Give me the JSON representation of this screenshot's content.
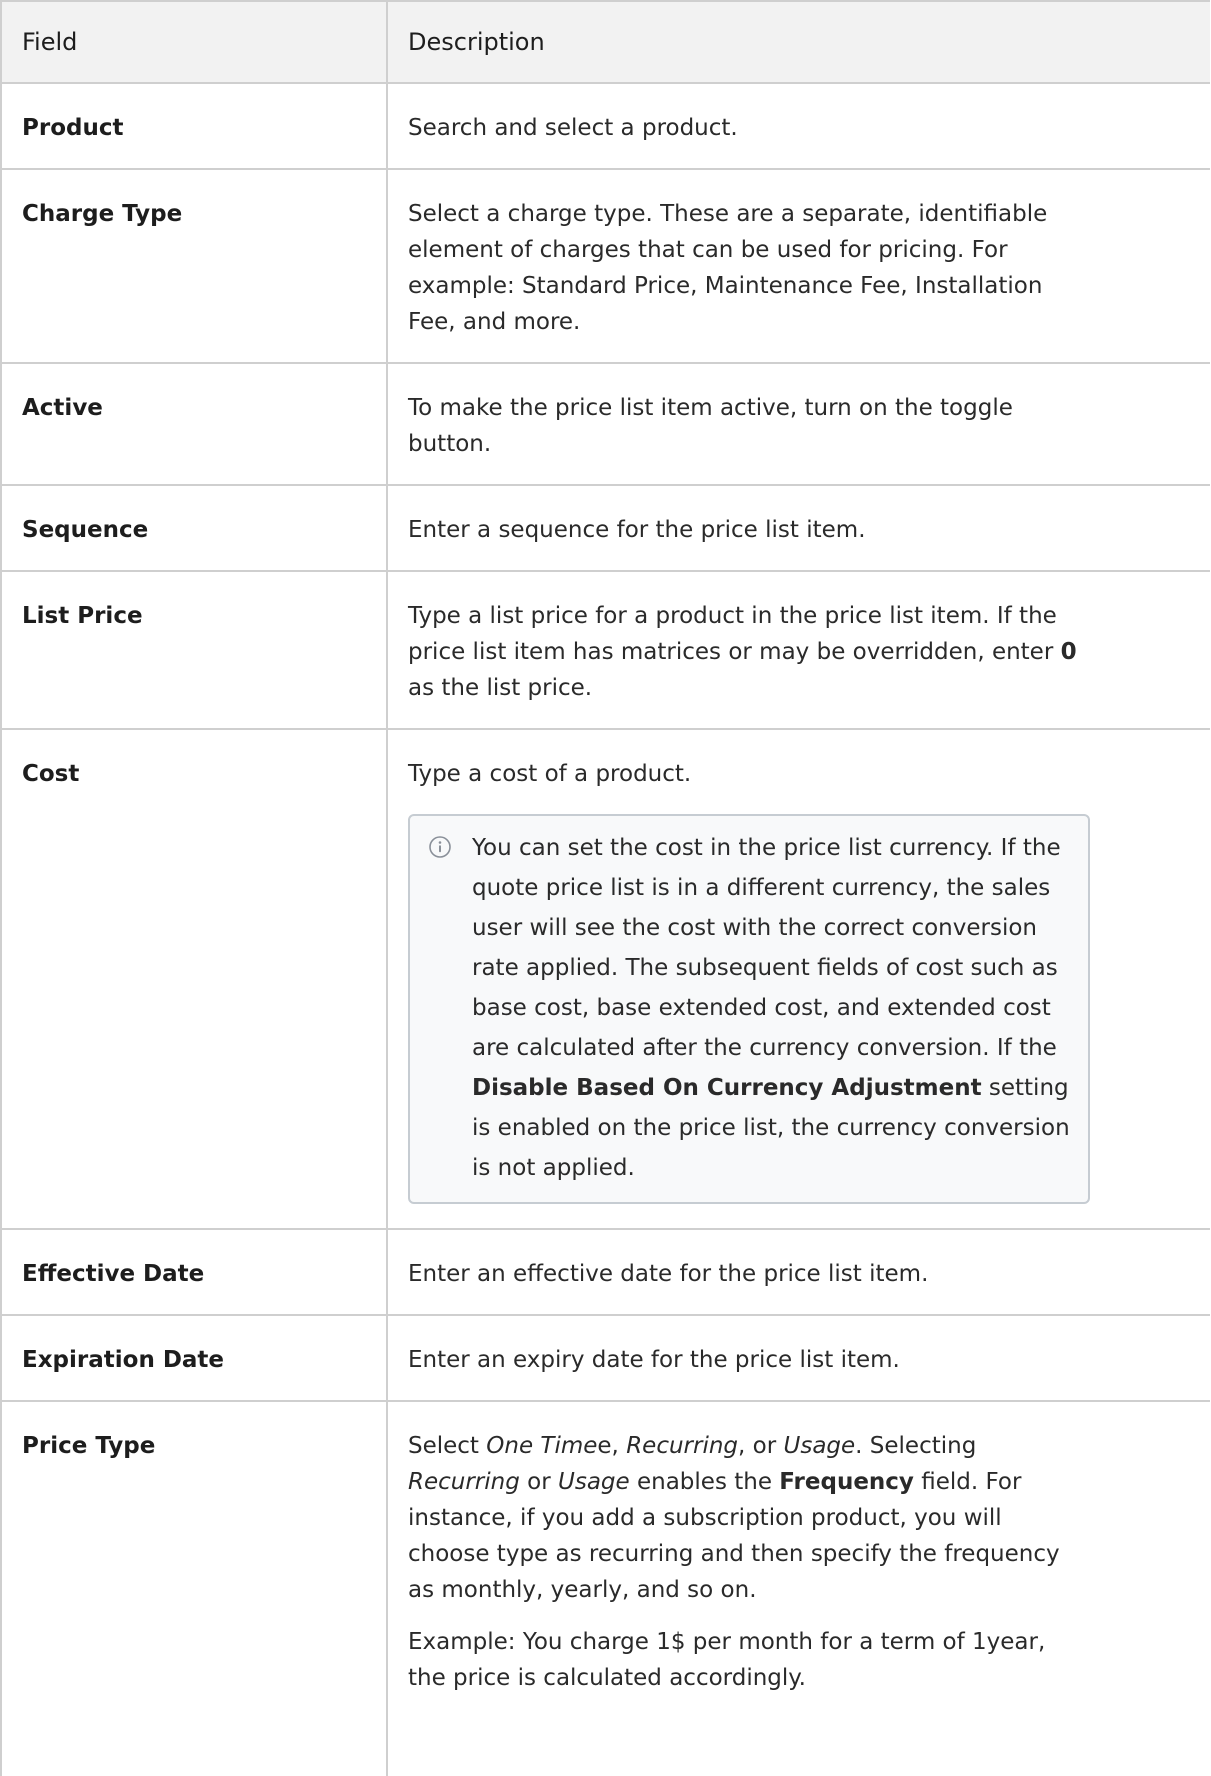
{
  "table": {
    "headers": {
      "field": "Field",
      "description": "Description"
    },
    "rows": [
      {
        "field": "Product",
        "description": "Search and select a product."
      },
      {
        "field": "Charge Type",
        "description": "Select a charge type. These are a separate, identifiable element of charges that can be used for pricing. For example: Standard Price, Maintenance Fee, Installation Fee, and more."
      },
      {
        "field": "Active",
        "description": "To make the price list item active, turn on the toggle button."
      },
      {
        "field": "Sequence",
        "description": "Enter a sequence for the price list item."
      },
      {
        "field": "List Price",
        "description": {
          "before": "Type a list price for a product in the price list item. If the price list item has matrices or may be overridden, enter ",
          "bold": "0",
          "after": " as the list price."
        }
      },
      {
        "field": "Cost",
        "description": "Type a cost of a product.",
        "note": {
          "icon": "info-icon",
          "before": "You can set the cost in the price list currency. If the quote price list is in a different currency, the sales user will see the cost with the correct conversion rate applied. The subsequent fields of cost such as base cost, base extended cost, and extended cost are calculated after the currency conversion. If the ",
          "bold": "Disable Based On Currency Adjustment",
          "after": " setting is enabled on the price list, the currency conversion is not applied."
        }
      },
      {
        "field": "Effective Date",
        "description": "Enter an effective date for the price list item."
      },
      {
        "field": "Expiration Date",
        "description": "Enter an expiry date for the price list item."
      },
      {
        "field": "Price Type",
        "description": {
          "t1": "Select ",
          "i1": "One Time",
          "t2": "e, ",
          "i2": "Recurring",
          "t3": ", or ",
          "i3": "Usage",
          "t4": ". Selecting ",
          "i4": "Recurring",
          "t5": " or ",
          "i5": "Usage",
          "t6": " enables the ",
          "b1": "Frequency",
          "t7": " field. For instance, if you add a subscription product, you will choose type as recurring and then specify the frequency as monthly, yearly, and so on.",
          "example": "Example: You charge 1$ per month for a term of 1year, the price is calculated accordingly."
        }
      }
    ]
  },
  "colors": {
    "border": "#cfcfcf",
    "header_bg": "#f2f2f2",
    "note_bg": "#f8f9fa",
    "note_border": "#c6ccd2"
  }
}
